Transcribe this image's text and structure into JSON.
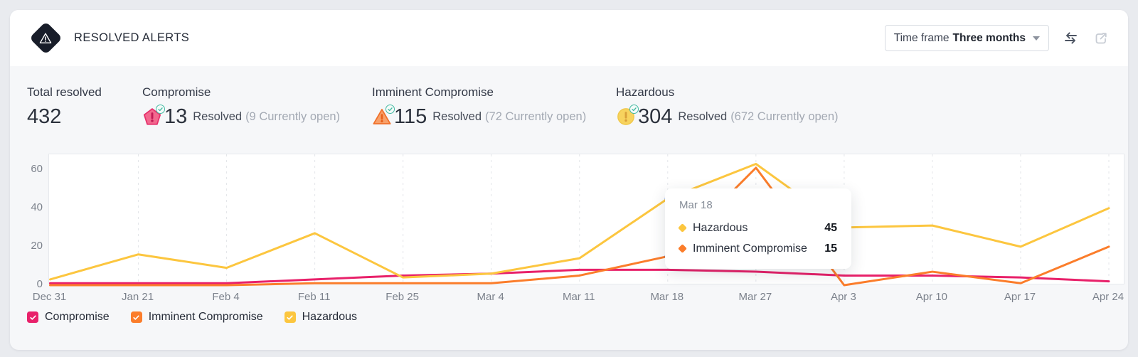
{
  "header": {
    "title": "RESOLVED ALERTS",
    "timeframe_label": "Time frame",
    "timeframe_value": "Three months"
  },
  "stats": {
    "total": {
      "label": "Total resolved",
      "value": "432"
    },
    "items": [
      {
        "label": "Compromise",
        "value": "13",
        "resolved_label": "Resolved",
        "open_note": "(9 Currently open)",
        "icon": "compromise-pentagon-icon",
        "color": "#e8216a"
      },
      {
        "label": "Imminent Compromise",
        "value": "115",
        "resolved_label": "Resolved",
        "open_note": "(72 Currently open)",
        "icon": "imminent-triangle-icon",
        "color": "#fb7d2b"
      },
      {
        "label": "Hazardous",
        "value": "304",
        "resolved_label": "Resolved",
        "open_note": "(672 Currently open)",
        "icon": "hazardous-circle-icon",
        "color": "#fcc63f"
      }
    ]
  },
  "chart_data": {
    "type": "line",
    "title": "Resolved alerts over three months",
    "categories": [
      "Dec 31",
      "Jan 21",
      "Feb 4",
      "Feb 11",
      "Feb 25",
      "Mar 4",
      "Mar 11",
      "Mar 18",
      "Mar 27",
      "Apr 3",
      "Apr 10",
      "Apr 17",
      "Apr 24"
    ],
    "series": [
      {
        "name": "Compromise",
        "color": "#e8216a",
        "values": [
          1,
          1,
          1,
          3,
          5,
          6,
          8,
          8,
          7,
          5,
          5,
          4,
          2
        ]
      },
      {
        "name": "Imminent Compromise",
        "color": "#fb7d2b",
        "values": [
          0,
          0,
          0,
          1,
          1,
          1,
          5,
          15,
          61,
          0,
          7,
          1,
          20
        ]
      },
      {
        "name": "Hazardous",
        "color": "#fcc63f",
        "values": [
          3,
          16,
          9,
          27,
          4,
          6,
          14,
          45,
          63,
          30,
          31,
          20,
          40
        ]
      }
    ],
    "yticks": [
      0,
      20,
      40,
      60
    ],
    "ylim": [
      0,
      68
    ],
    "grid": "vertical-dashed",
    "gridline_color": "#e3e5e9",
    "legend_position": "bottom",
    "highlight": {
      "category": "Mar 18",
      "index": 7,
      "dot_color": "#3e7cf7",
      "points": [
        {
          "series": "Hazardous",
          "value": 45
        },
        {
          "series": "Imminent Compromise",
          "value": 15
        }
      ]
    }
  },
  "tooltip": {
    "title": "Mar 18",
    "rows": [
      {
        "label": "Hazardous",
        "value": "45",
        "color": "#fcc63f"
      },
      {
        "label": "Imminent Compromise",
        "value": "15",
        "color": "#fb7d2b"
      }
    ]
  },
  "legend": {
    "items": [
      {
        "label": "Compromise",
        "color": "#e8216a"
      },
      {
        "label": "Imminent Compromise",
        "color": "#fb7d2b"
      },
      {
        "label": "Hazardous",
        "color": "#fcc63f"
      }
    ]
  }
}
